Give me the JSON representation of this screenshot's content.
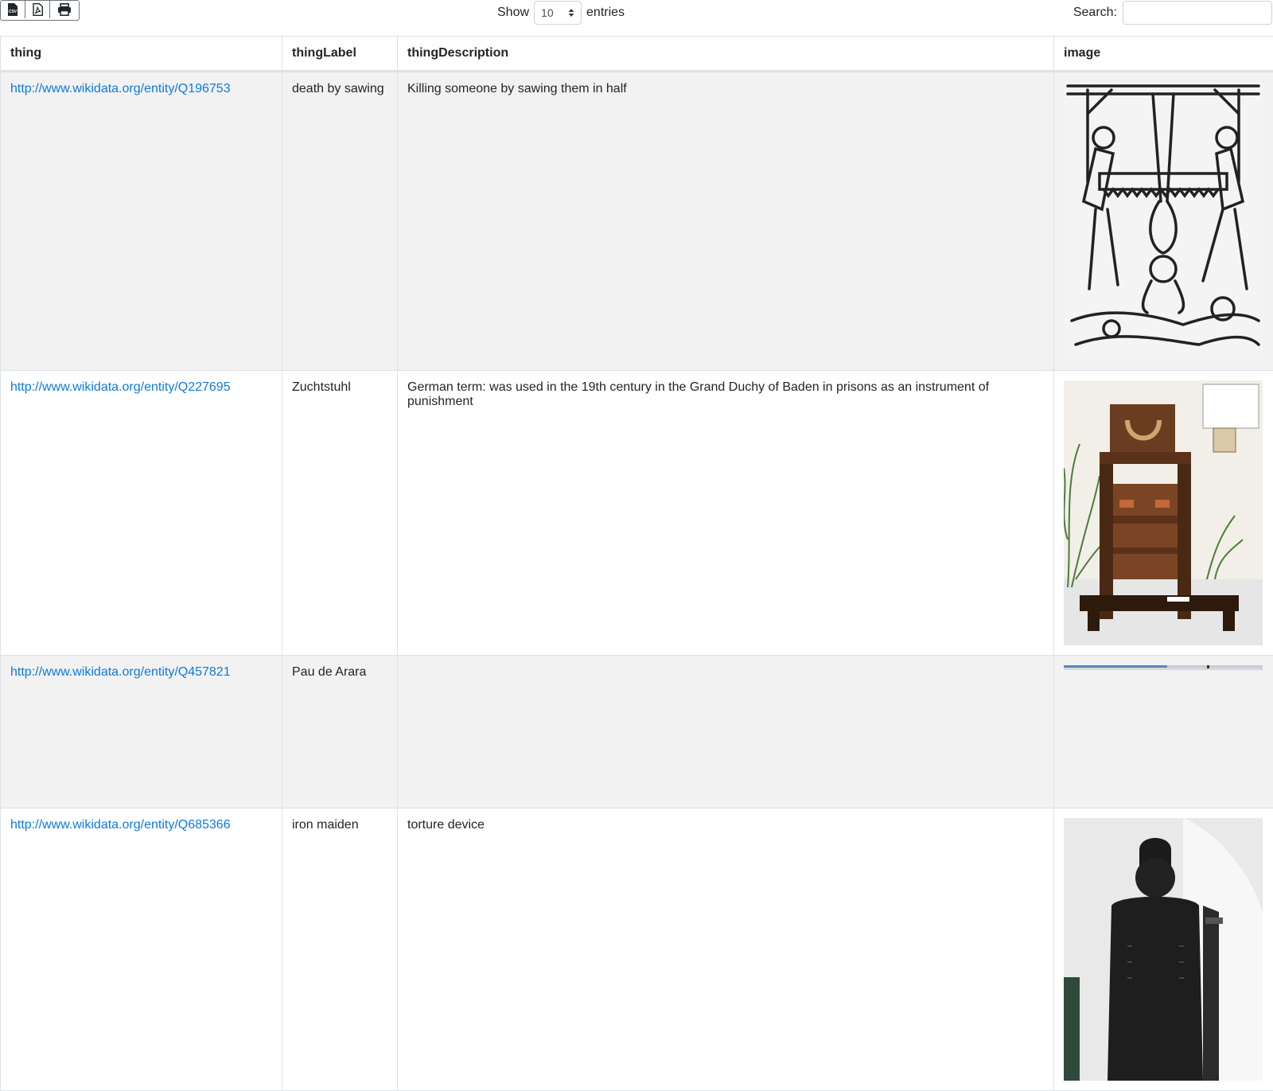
{
  "toolbar": {
    "csv_label": "CSV",
    "pdf_icon": "pdf-file-icon",
    "print_icon": "printer-icon"
  },
  "length": {
    "show_label": "Show",
    "selected": "10",
    "entries_label": "entries"
  },
  "search": {
    "label": "Search:",
    "value": ""
  },
  "table": {
    "headers": [
      "thing",
      "thingLabel",
      "thingDescription",
      "image"
    ],
    "rows": [
      {
        "thing": "http://www.wikidata.org/entity/Q196753",
        "label": "death by sawing",
        "description": "Killing someone by sawing them in half"
      },
      {
        "thing": "http://www.wikidata.org/entity/Q227695",
        "label": "Zuchtstuhl",
        "description": "German term: was used in the 19th century in the Grand Duchy of Baden in prisons as an instrument of punishment"
      },
      {
        "thing": "http://www.wikidata.org/entity/Q457821",
        "label": "Pau de Arara",
        "description": ""
      },
      {
        "thing": "http://www.wikidata.org/entity/Q685366",
        "label": "iron maiden",
        "description": "torture device"
      }
    ]
  },
  "colors": {
    "link": "#0d7bdb",
    "stripe": "#f2f2f2",
    "border": "#dee2e6"
  }
}
